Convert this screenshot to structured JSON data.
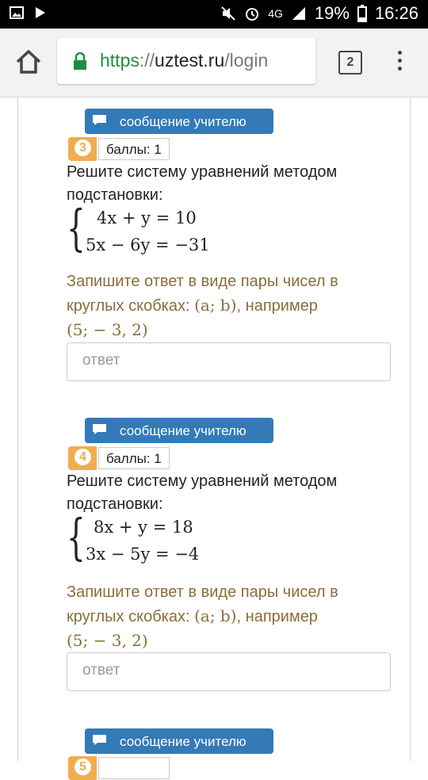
{
  "status_bar": {
    "network": "4G",
    "battery": "19%",
    "time": "16:26"
  },
  "browser": {
    "url_scheme": "https",
    "url_sep": "://",
    "url_host": "uztest.ru",
    "url_path": "/login",
    "tab_count": "2"
  },
  "ui": {
    "message_button": "сообщение   учителю",
    "answer_placeholder": "ответ",
    "hint_prefix": "Запишите ответ в виде пары чисел в круглых скобках: ",
    "hint_example_pair": "(a; b)",
    "hint_suffix": ", например",
    "hint_example": "(5;  − 3, 2)"
  },
  "questions": [
    {
      "number": "3",
      "points": "баллы: 1",
      "text": "Решите систему уравнений методом подстановки:",
      "eq1": "4x + y = 10",
      "eq2": "5x − 6y = −31"
    },
    {
      "number": "4",
      "points": "баллы: 1",
      "text": "Решите систему уравнений методом подстановки:",
      "eq1": "8x + y = 18",
      "eq2": "3x − 5y = −4"
    },
    {
      "number": "5"
    }
  ],
  "colors": {
    "primary": "#337ab7",
    "badge": "#f0ad4e",
    "hint": "#8a6d3b",
    "url_secure": "#1e8e3e"
  }
}
